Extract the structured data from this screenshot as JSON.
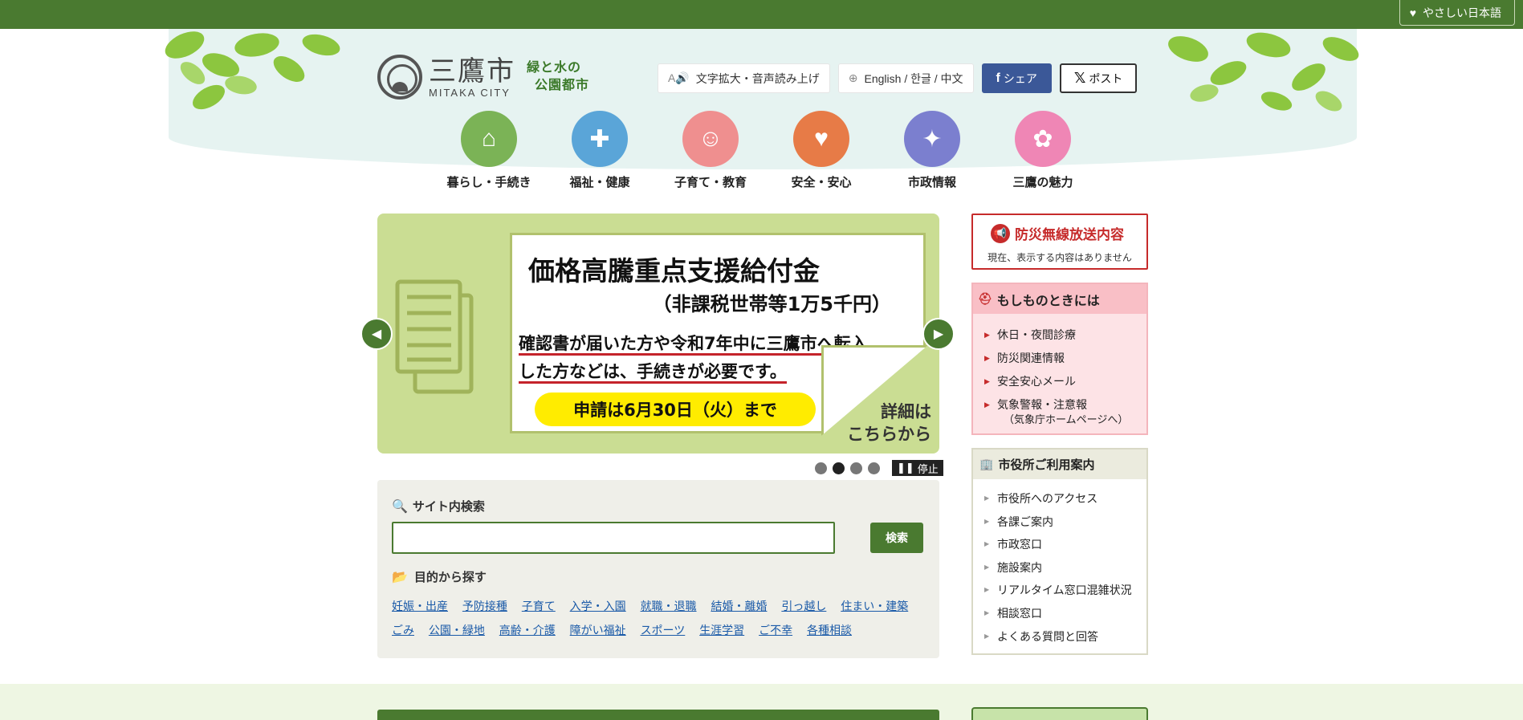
{
  "topbar": {
    "yasashii_label": "やさしい日本語"
  },
  "logo": {
    "kanji": "三鷹市",
    "roman": "MITAKA CITY",
    "slogan_line1": "緑と水の",
    "slogan_line2": "公園都市"
  },
  "header_tools": {
    "text_size_label": "文字拡大・音声読み上げ",
    "language_label": "English / 한글 / 中文",
    "facebook_label": "シェア",
    "x_label": "ポスト"
  },
  "gnav": [
    {
      "label": "暮らし・手続き",
      "color": "#7bb356",
      "icon": "house-icon"
    },
    {
      "label": "福祉・健康",
      "color": "#5aa5d8",
      "icon": "doctor-icon"
    },
    {
      "label": "子育て・教育",
      "color": "#ef8f8f",
      "icon": "baby-icon"
    },
    {
      "label": "安全・安心",
      "color": "#e77b47",
      "icon": "heart-hands-icon"
    },
    {
      "label": "市政情報",
      "color": "#7b7fcf",
      "icon": "bird-icon"
    },
    {
      "label": "三鷹の魅力",
      "color": "#ef86b5",
      "icon": "flower-icon"
    }
  ],
  "slider": {
    "title": "価格高騰重点支援給付金",
    "subtitle": "（非課税世帯等1万5千円）",
    "note_line1": "確認書が届いた方や令和7年中に三鷹市へ転入",
    "note_line2": "した方などは、手続きが必要です。",
    "deadline": "申請は6月30日（火）まで",
    "detail_line1": "詳細は",
    "detail_line2": "こちらから",
    "stop_label": "停止",
    "current_slide": 2,
    "total_slides": 4
  },
  "search": {
    "heading": "サイト内検索",
    "input_value": "",
    "button_label": "検索",
    "purpose_heading": "目的から探す",
    "links": [
      "妊娠・出産",
      "予防接種",
      "子育て",
      "入学・入園",
      "就職・退職",
      "結婚・離婚",
      "引っ越し",
      "住まい・建築",
      "ごみ",
      "公園・緑地",
      "高齢・介護",
      "障がい福祉",
      "スポーツ",
      "生涯学習",
      "ご不幸",
      "各種相談"
    ]
  },
  "bousai": {
    "title": "防災無線放送内容",
    "message": "現在、表示する内容はありません"
  },
  "emergency": {
    "heading": "もしものときには",
    "items": [
      "休日・夜間診療",
      "防災関連情報",
      "安全安心メール",
      "気象警報・注意報"
    ],
    "item4_sub": "（気象庁ホームページへ）"
  },
  "guide": {
    "heading": "市役所ご利用案内",
    "items": [
      "市役所へのアクセス",
      "各課ご案内",
      "市政窓口",
      "施設案内",
      "リアルタイム窓口混雑状況",
      "相談窓口",
      "よくある質問と回答"
    ]
  },
  "colors": {
    "brand_green": "#4a7a30",
    "alert_red": "#c62b2b",
    "link_blue": "#1a5aa8"
  }
}
